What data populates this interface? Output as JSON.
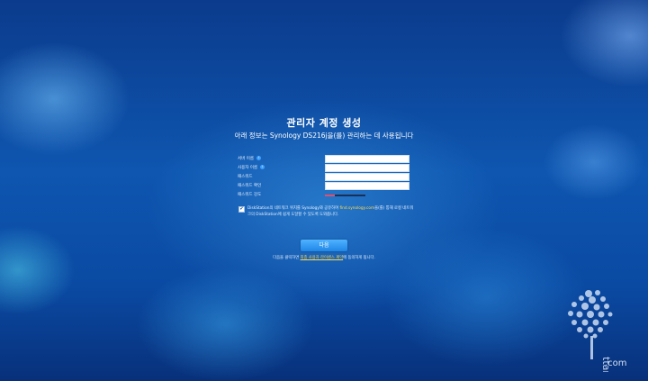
{
  "header": {
    "title": "관리자 계정 생성",
    "subtitle": "아래 정보는 Synology DS216j을(를) 관리하는 데 사용됩니다"
  },
  "form": {
    "fields": [
      {
        "label": "서버 이름",
        "has_info": true,
        "value": ""
      },
      {
        "label": "사용자 이름",
        "has_info": true,
        "value": ""
      },
      {
        "label": "패스워드",
        "has_info": false,
        "value": ""
      },
      {
        "label": "패스워드 확인",
        "has_info": false,
        "value": ""
      }
    ],
    "strength_label": "패스워드 강도",
    "strength_level": 0.25
  },
  "checkbox": {
    "checked": true,
    "text_before": "DiskStation의 네트워크 위치를 Synology와 공유하여 ",
    "link": "find.synology.com",
    "text_after": "을(를) 통해 로컬 네트워크의 DiskStation에 쉽게 도달할 수 있도록 도와줍니다."
  },
  "next_button": "다음",
  "terms": {
    "before": "다음을 클릭하면 ",
    "link": "최종 사용자 라이센스 계약",
    "after": "에 동의하게 됩니다."
  },
  "watermark": {
    "vertical": "ttamu",
    "domain": ".com"
  },
  "colors": {
    "accent": "#2a8ff0",
    "link": "#ffd84a",
    "strength_fill": "#e0506e"
  }
}
